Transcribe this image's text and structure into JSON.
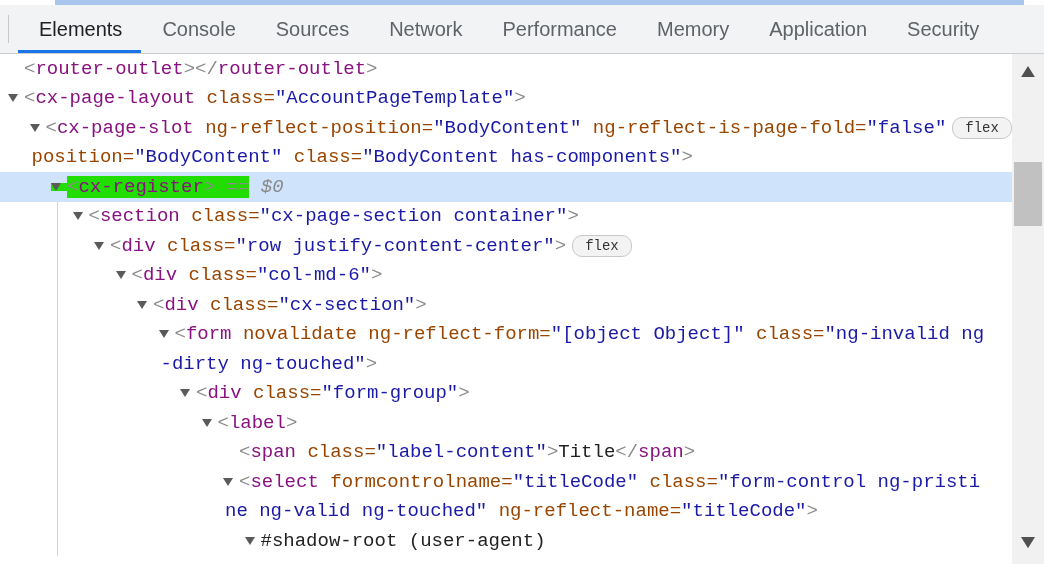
{
  "tabs": [
    {
      "label": "Elements",
      "selected": true
    },
    {
      "label": "Console",
      "selected": false
    },
    {
      "label": "Sources",
      "selected": false
    },
    {
      "label": "Network",
      "selected": false
    },
    {
      "label": "Performance",
      "selected": false
    },
    {
      "label": "Memory",
      "selected": false
    },
    {
      "label": "Application",
      "selected": false
    },
    {
      "label": "Security",
      "selected": false
    }
  ],
  "dom_tree": [
    {
      "expanded": false,
      "selected": false,
      "lines": [
        [
          {
            "kind": "punct",
            "text": "<"
          },
          {
            "kind": "tag",
            "text": "router-outlet"
          },
          {
            "kind": "punct",
            "text": "></"
          },
          {
            "kind": "tag",
            "text": "router-outlet"
          },
          {
            "kind": "punct",
            "text": ">"
          }
        ]
      ]
    },
    {
      "expanded": true,
      "selected": false,
      "lines": [
        [
          {
            "kind": "punct",
            "text": "<"
          },
          {
            "kind": "tag",
            "text": "cx-page-layout"
          },
          {
            "kind": "attr",
            "text": " class="
          },
          {
            "kind": "value",
            "text": "\"AccountPageTemplate\""
          },
          {
            "kind": "punct",
            "text": ">"
          }
        ]
      ],
      "children": [
        {
          "expanded": true,
          "selected": false,
          "lines": [
            [
              {
                "kind": "punct",
                "text": "<"
              },
              {
                "kind": "tag",
                "text": "cx-page-slot"
              },
              {
                "kind": "attr",
                "text": " ng-reflect-position="
              },
              {
                "kind": "value",
                "text": "\"BodyContent\""
              },
              {
                "kind": "attr",
                "text": " ng-reflect-is-page-fold="
              },
              {
                "kind": "value",
                "text": "\"false\""
              }
            ],
            [
              {
                "kind": "attr",
                "text": "position="
              },
              {
                "kind": "value",
                "text": "\"BodyContent\""
              },
              {
                "kind": "attr",
                "text": " class="
              },
              {
                "kind": "value",
                "text": "\"BodyContent has-components\""
              },
              {
                "kind": "punct",
                "text": ">"
              }
            ]
          ],
          "badge": "flex",
          "children": [
            {
              "expanded": true,
              "selected": true,
              "lines": [
                [
                  {
                    "kind": "punct",
                    "text": "<",
                    "highlight": true
                  },
                  {
                    "kind": "tag",
                    "text": "cx-register",
                    "highlight": true
                  },
                  {
                    "kind": "punct",
                    "text": ">",
                    "highlight": true
                  },
                  {
                    "kind": "meta",
                    "text": " ==",
                    "highlight": true
                  },
                  {
                    "kind": "meta",
                    "text": " $0",
                    "highlight": false
                  }
                ]
              ],
              "children": [
                {
                  "expanded": true,
                  "selected": false,
                  "lines": [
                    [
                      {
                        "kind": "punct",
                        "text": "<"
                      },
                      {
                        "kind": "tag",
                        "text": "section"
                      },
                      {
                        "kind": "attr",
                        "text": " class="
                      },
                      {
                        "kind": "value",
                        "text": "\"cx-page-section container\""
                      },
                      {
                        "kind": "punct",
                        "text": ">"
                      }
                    ]
                  ],
                  "children": [
                    {
                      "expanded": true,
                      "selected": false,
                      "lines": [
                        [
                          {
                            "kind": "punct",
                            "text": "<"
                          },
                          {
                            "kind": "tag",
                            "text": "div"
                          },
                          {
                            "kind": "attr",
                            "text": " class="
                          },
                          {
                            "kind": "value",
                            "text": "\"row justify-content-center\""
                          },
                          {
                            "kind": "punct",
                            "text": ">"
                          }
                        ]
                      ],
                      "badge": "flex",
                      "children": [
                        {
                          "expanded": true,
                          "selected": false,
                          "lines": [
                            [
                              {
                                "kind": "punct",
                                "text": "<"
                              },
                              {
                                "kind": "tag",
                                "text": "div"
                              },
                              {
                                "kind": "attr",
                                "text": " class="
                              },
                              {
                                "kind": "value",
                                "text": "\"col-md-6\""
                              },
                              {
                                "kind": "punct",
                                "text": ">"
                              }
                            ]
                          ],
                          "children": [
                            {
                              "expanded": true,
                              "selected": false,
                              "lines": [
                                [
                                  {
                                    "kind": "punct",
                                    "text": "<"
                                  },
                                  {
                                    "kind": "tag",
                                    "text": "div"
                                  },
                                  {
                                    "kind": "attr",
                                    "text": " class="
                                  },
                                  {
                                    "kind": "value",
                                    "text": "\"cx-section\""
                                  },
                                  {
                                    "kind": "punct",
                                    "text": ">"
                                  }
                                ]
                              ],
                              "children": [
                                {
                                  "expanded": true,
                                  "selected": false,
                                  "lines": [
                                    [
                                      {
                                        "kind": "punct",
                                        "text": "<"
                                      },
                                      {
                                        "kind": "tag",
                                        "text": "form"
                                      },
                                      {
                                        "kind": "attr",
                                        "text": " novalidate ng-reflect-form="
                                      },
                                      {
                                        "kind": "value",
                                        "text": "\"[object Object]\""
                                      },
                                      {
                                        "kind": "attr",
                                        "text": " class="
                                      },
                                      {
                                        "kind": "value",
                                        "text": "\"ng-invalid ng"
                                      }
                                    ],
                                    [
                                      {
                                        "kind": "value",
                                        "text": "-dirty ng-touched\""
                                      },
                                      {
                                        "kind": "punct",
                                        "text": ">"
                                      }
                                    ]
                                  ],
                                  "children": [
                                    {
                                      "expanded": true,
                                      "selected": false,
                                      "lines": [
                                        [
                                          {
                                            "kind": "punct",
                                            "text": "<"
                                          },
                                          {
                                            "kind": "tag",
                                            "text": "div"
                                          },
                                          {
                                            "kind": "attr",
                                            "text": " class="
                                          },
                                          {
                                            "kind": "value",
                                            "text": "\"form-group\""
                                          },
                                          {
                                            "kind": "punct",
                                            "text": ">"
                                          }
                                        ]
                                      ],
                                      "children": [
                                        {
                                          "expanded": true,
                                          "selected": false,
                                          "lines": [
                                            [
                                              {
                                                "kind": "punct",
                                                "text": "<"
                                              },
                                              {
                                                "kind": "tag",
                                                "text": "label"
                                              },
                                              {
                                                "kind": "punct",
                                                "text": ">"
                                              }
                                            ]
                                          ],
                                          "children": [
                                            {
                                              "expanded": false,
                                              "selected": false,
                                              "lines": [
                                                [
                                                  {
                                                    "kind": "punct",
                                                    "text": "<"
                                                  },
                                                  {
                                                    "kind": "tag",
                                                    "text": "span"
                                                  },
                                                  {
                                                    "kind": "attr",
                                                    "text": " class="
                                                  },
                                                  {
                                                    "kind": "value",
                                                    "text": "\"label-content\""
                                                  },
                                                  {
                                                    "kind": "punct",
                                                    "text": ">"
                                                  },
                                                  {
                                                    "kind": "text",
                                                    "text": "Title"
                                                  },
                                                  {
                                                    "kind": "punct",
                                                    "text": "</"
                                                  },
                                                  {
                                                    "kind": "tag",
                                                    "text": "span"
                                                  },
                                                  {
                                                    "kind": "punct",
                                                    "text": ">"
                                                  }
                                                ]
                                              ]
                                            },
                                            {
                                              "expanded": true,
                                              "selected": false,
                                              "lines": [
                                                [
                                                  {
                                                    "kind": "punct",
                                                    "text": "<"
                                                  },
                                                  {
                                                    "kind": "tag",
                                                    "text": "select"
                                                  },
                                                  {
                                                    "kind": "attr",
                                                    "text": " formcontrolname="
                                                  },
                                                  {
                                                    "kind": "value",
                                                    "text": "\"titleCode\""
                                                  },
                                                  {
                                                    "kind": "attr",
                                                    "text": " class="
                                                  },
                                                  {
                                                    "kind": "value",
                                                    "text": "\"form-control ng-pristi"
                                                  }
                                                ],
                                                [
                                                  {
                                                    "kind": "value",
                                                    "text": "ne ng-valid ng-touched\""
                                                  },
                                                  {
                                                    "kind": "attr",
                                                    "text": " ng-reflect-name="
                                                  },
                                                  {
                                                    "kind": "value",
                                                    "text": "\"titleCode\""
                                                  },
                                                  {
                                                    "kind": "punct",
                                                    "text": ">"
                                                  }
                                                ]
                                              ],
                                              "children": [
                                                {
                                                  "expanded": true,
                                                  "selected": false,
                                                  "lines": [
                                                    [
                                                      {
                                                        "kind": "text",
                                                        "text": "#shadow-root (user-agent)"
                                                      }
                                                    ]
                                                  ]
                                                }
                                              ]
                                            }
                                          ]
                                        }
                                      ]
                                    }
                                  ]
                                }
                              ]
                            }
                          ]
                        }
                      ]
                    }
                  ]
                }
              ]
            }
          ]
        }
      ]
    }
  ]
}
